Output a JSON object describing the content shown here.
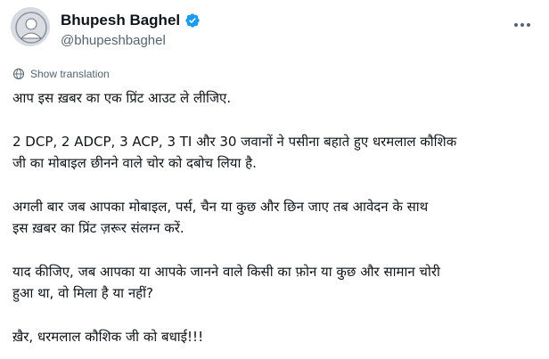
{
  "author": {
    "display_name": "Bhupesh Baghel",
    "handle": "@bhupeshbaghel",
    "verified_color": "#1d9bf0"
  },
  "translate": {
    "label": "Show translation",
    "icon": "globe-icon"
  },
  "tweet": {
    "line_1": "आप इस ख़बर का एक प्रिंट आउट ले लीजिए.",
    "line_2": "2 DCP, 2 ADCP, 3 ACP, 3 TI और 30 जवानों ने पसीना बहाते हुए धरमलाल कौशिक",
    "line_3": "जी का मोबाइल छीनने वाले चोर को दबोच लिया है.",
    "line_4": "अगली बार जब आपका मोबाइल, पर्स, चैन या कुछ और छिन जाए तब आवेदन के साथ",
    "line_5": "इस ख़बर का प्रिंट ज़रूर संलग्न करें.",
    "line_6": "याद कीजिए, जब आपका या आपके जानने वाले किसी का फ़ोन या कुछ और सामान चोरी",
    "line_7": "हुआ था, वो मिला है या नहीं?",
    "line_8": "ख़ैर, धरमलाल कौशिक जी को बधाई!!!"
  }
}
